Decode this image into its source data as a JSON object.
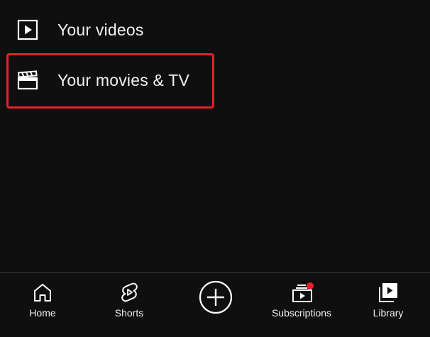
{
  "menu": {
    "items": [
      {
        "label": "Your videos",
        "icon": "play-box-icon"
      },
      {
        "label": "Your movies & TV",
        "icon": "clapperboard-icon"
      }
    ]
  },
  "bottom_nav": {
    "items": [
      {
        "label": "Home",
        "icon": "home-icon"
      },
      {
        "label": "Shorts",
        "icon": "shorts-icon"
      },
      {
        "label": "",
        "icon": "create-plus-icon"
      },
      {
        "label": "Subscriptions",
        "icon": "subscriptions-icon"
      },
      {
        "label": "Library",
        "icon": "library-icon"
      }
    ]
  },
  "colors": {
    "background": "#0f0f0f",
    "text": "#f1f1f1",
    "highlight": "#e8202a",
    "notification_dot": "#e8202a"
  }
}
